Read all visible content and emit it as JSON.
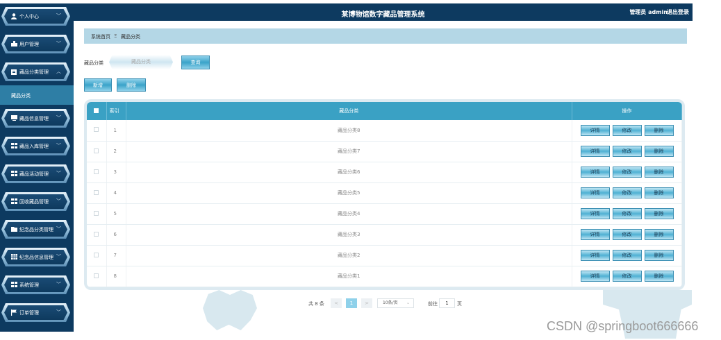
{
  "header": {
    "title": "某博物馆数字藏品管理系统",
    "user": "管理员 admin",
    "logout": "退出登录"
  },
  "sidebar": {
    "items": [
      {
        "label": "个人中心",
        "icon": "user-icon"
      },
      {
        "label": "用户管理",
        "icon": "users-icon"
      },
      {
        "label": "藏品分类管理",
        "icon": "clipboard-icon"
      },
      {
        "label": "藏品信息管理",
        "icon": "monitor-icon"
      },
      {
        "label": "藏品入库管理",
        "icon": "grid-icon"
      },
      {
        "label": "藏品活动管理",
        "icon": "grid-icon"
      },
      {
        "label": "回收藏品管理",
        "icon": "grid-icon"
      },
      {
        "label": "纪念品分类管理",
        "icon": "folder-icon"
      },
      {
        "label": "纪念品信息管理",
        "icon": "table-icon"
      },
      {
        "label": "系统管理",
        "icon": "grid-icon"
      },
      {
        "label": "订单管理",
        "icon": "flag-icon"
      }
    ],
    "active_sub": "藏品分类"
  },
  "breadcrumb": {
    "home": "系统首页",
    "separator": "Ξ",
    "current": "藏品分类"
  },
  "search": {
    "label": "藏品分类",
    "placeholder": "藏品分类",
    "query_button": "查询"
  },
  "actions": {
    "add": "新增",
    "delete": "删除"
  },
  "table": {
    "columns": [
      "索引",
      "藏品分类",
      "操作"
    ],
    "rows": [
      {
        "index": "1",
        "category": "藏品分类8"
      },
      {
        "index": "2",
        "category": "藏品分类7"
      },
      {
        "index": "3",
        "category": "藏品分类6"
      },
      {
        "index": "4",
        "category": "藏品分类5"
      },
      {
        "index": "5",
        "category": "藏品分类4"
      },
      {
        "index": "6",
        "category": "藏品分类3"
      },
      {
        "index": "7",
        "category": "藏品分类2"
      },
      {
        "index": "8",
        "category": "藏品分类1"
      }
    ],
    "row_actions": {
      "detail": "详情",
      "edit": "修改",
      "delete": "删除"
    }
  },
  "pagination": {
    "total": "共 8 条",
    "prev": "<",
    "current_page": "1",
    "next": ">",
    "page_size": "10条/页",
    "goto_label": "前往",
    "goto_value": "1",
    "page_suffix": "页"
  },
  "watermark": "CSDN @springboot666666",
  "colors": {
    "nav_dark": "#0d3a60",
    "accent": "#3aa1c4",
    "breadcrumb_bg": "#b4d7e6",
    "active_sub_bg": "#2e7ea5"
  }
}
